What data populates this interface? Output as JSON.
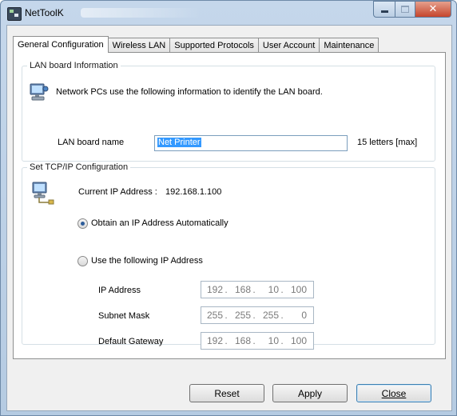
{
  "window": {
    "title": "NetToolK"
  },
  "tabs": [
    {
      "label": "General Configuration",
      "active": true
    },
    {
      "label": "Wireless LAN"
    },
    {
      "label": "Supported Protocols"
    },
    {
      "label": "User Account"
    },
    {
      "label": "Maintenance"
    }
  ],
  "lan_group": {
    "title": "LAN board Information",
    "description": "Network PCs use the following information to identify the LAN board.",
    "name_label": "LAN board name",
    "name_value": "Net Printer",
    "max_hint": "15 letters [max]"
  },
  "tcp_group": {
    "title": "Set TCP/IP Configuration",
    "current_ip_label": "Current IP Address :",
    "current_ip_value": "192.168.1.100",
    "radio_auto": "Obtain an IP Address Automatically",
    "radio_manual": "Use the following IP Address",
    "selected": "auto",
    "ip_label": "IP Address",
    "ip": [
      "192",
      "168",
      "10",
      "100"
    ],
    "mask_label": "Subnet Mask",
    "mask": [
      "255",
      "255",
      "255",
      "0"
    ],
    "gateway_label": "Default Gateway",
    "gateway": [
      "192",
      "168",
      "10",
      "100"
    ]
  },
  "buttons": {
    "reset": "Reset",
    "apply": "Apply",
    "close": "Close"
  },
  "colors": {
    "selection": "#3399ff",
    "titlebar": "#c5d7eb",
    "close_button": "#c5452c"
  }
}
